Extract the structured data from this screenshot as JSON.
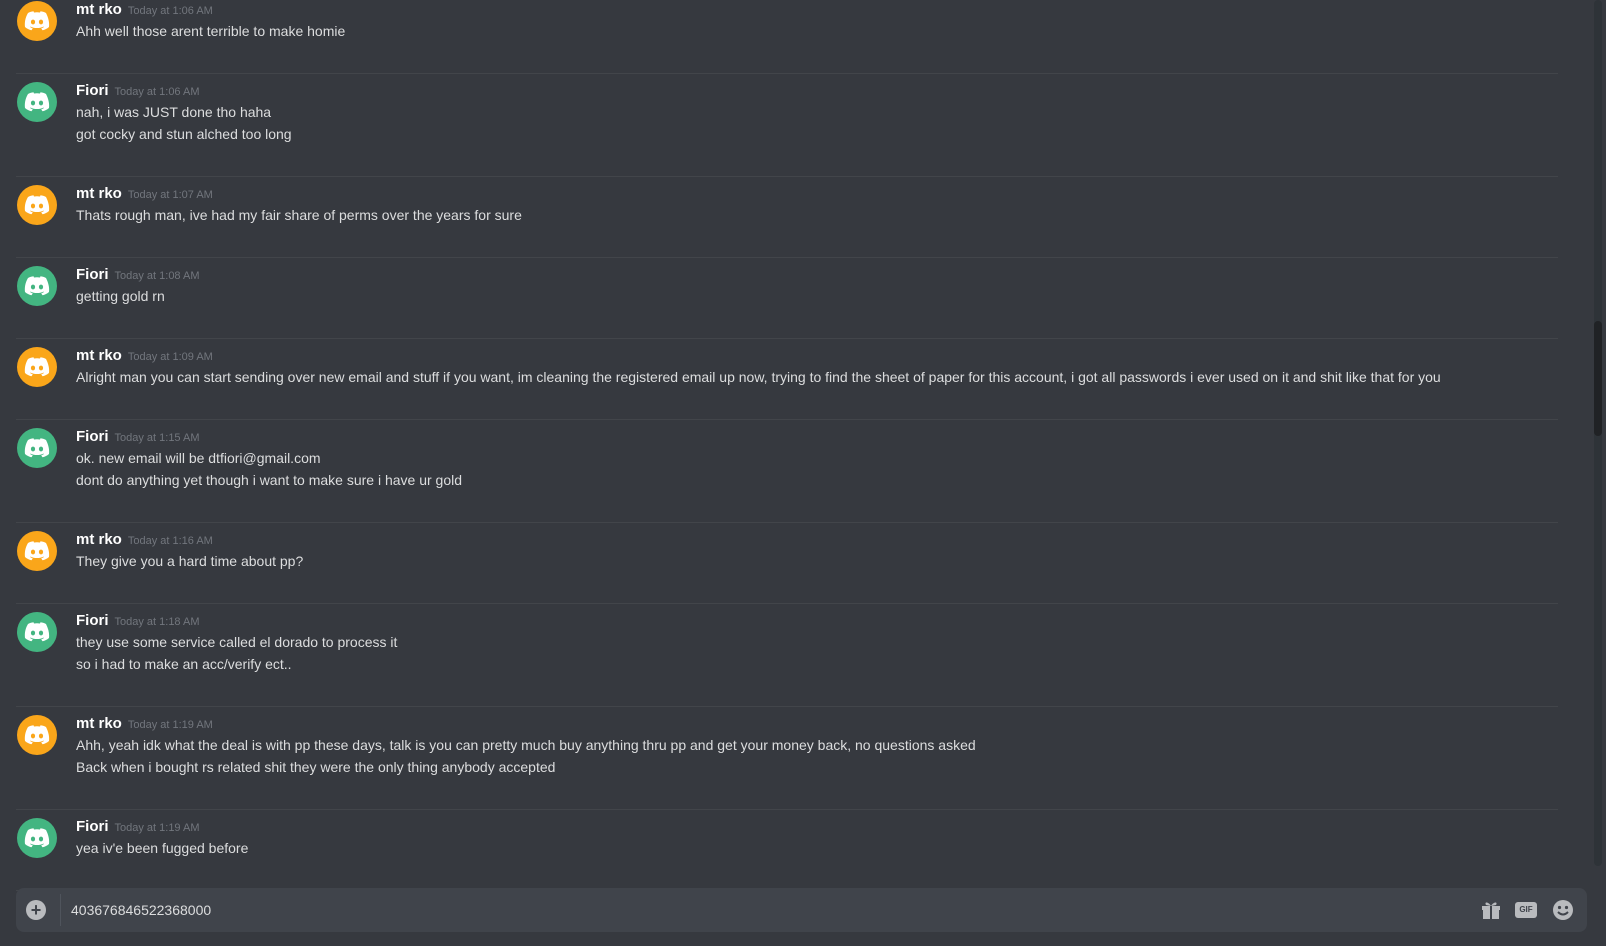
{
  "colors": {
    "background": "#36393f",
    "avatar_orange": "#faa61a",
    "avatar_green": "#43b581",
    "composer_bg": "#40444b"
  },
  "messages": [
    {
      "user": "mt rko",
      "avatar": "orange",
      "time": "Today at 1:06 AM",
      "lines": [
        "Ahh well those arent terrible to make homie"
      ]
    },
    {
      "user": "Fiori",
      "avatar": "green",
      "time": "Today at 1:06 AM",
      "lines": [
        "nah, i was JUST done tho haha",
        "got cocky and stun alched too long"
      ]
    },
    {
      "user": "mt rko",
      "avatar": "orange",
      "time": "Today at 1:07 AM",
      "lines": [
        "Thats rough man, ive had my fair share of perms over the years for sure"
      ]
    },
    {
      "user": "Fiori",
      "avatar": "green",
      "time": "Today at 1:08 AM",
      "lines": [
        "getting gold rn"
      ]
    },
    {
      "user": "mt rko",
      "avatar": "orange",
      "time": "Today at 1:09 AM",
      "lines": [
        "Alright man you can start sending over new email and stuff if you want, im cleaning the registered email up now, trying to find the sheet of paper for this account, i got all passwords i ever used on it and shit like that for you"
      ]
    },
    {
      "user": "Fiori",
      "avatar": "green",
      "time": "Today at 1:15 AM",
      "lines": [
        "ok. new email will be dtfiori@gmail.com",
        "dont do anything yet though i want to make sure i have ur gold"
      ]
    },
    {
      "user": "mt rko",
      "avatar": "orange",
      "time": "Today at 1:16 AM",
      "lines": [
        "They give you a hard time about pp?"
      ]
    },
    {
      "user": "Fiori",
      "avatar": "green",
      "time": "Today at 1:18 AM",
      "lines": [
        "they use some service called el dorado to process it",
        "so i had to make an acc/verify ect.."
      ]
    },
    {
      "user": "mt rko",
      "avatar": "orange",
      "time": "Today at 1:19 AM",
      "lines": [
        "Ahh, yeah idk what the deal is with pp these days, talk is you can pretty much buy anything thru pp and get your money back, no questions asked",
        "Back when i bought rs related shit they were the only thing anybody accepted"
      ]
    },
    {
      "user": "Fiori",
      "avatar": "green",
      "time": "Today at 1:19 AM",
      "lines": [
        "yea iv'e been fugged before"
      ]
    }
  ],
  "composer": {
    "text": "403676846522368000",
    "add_icon": "plus-circle-icon",
    "gift_icon": "gift-icon",
    "gif_label": "GIF",
    "emoji_icon": "emoji-icon"
  }
}
